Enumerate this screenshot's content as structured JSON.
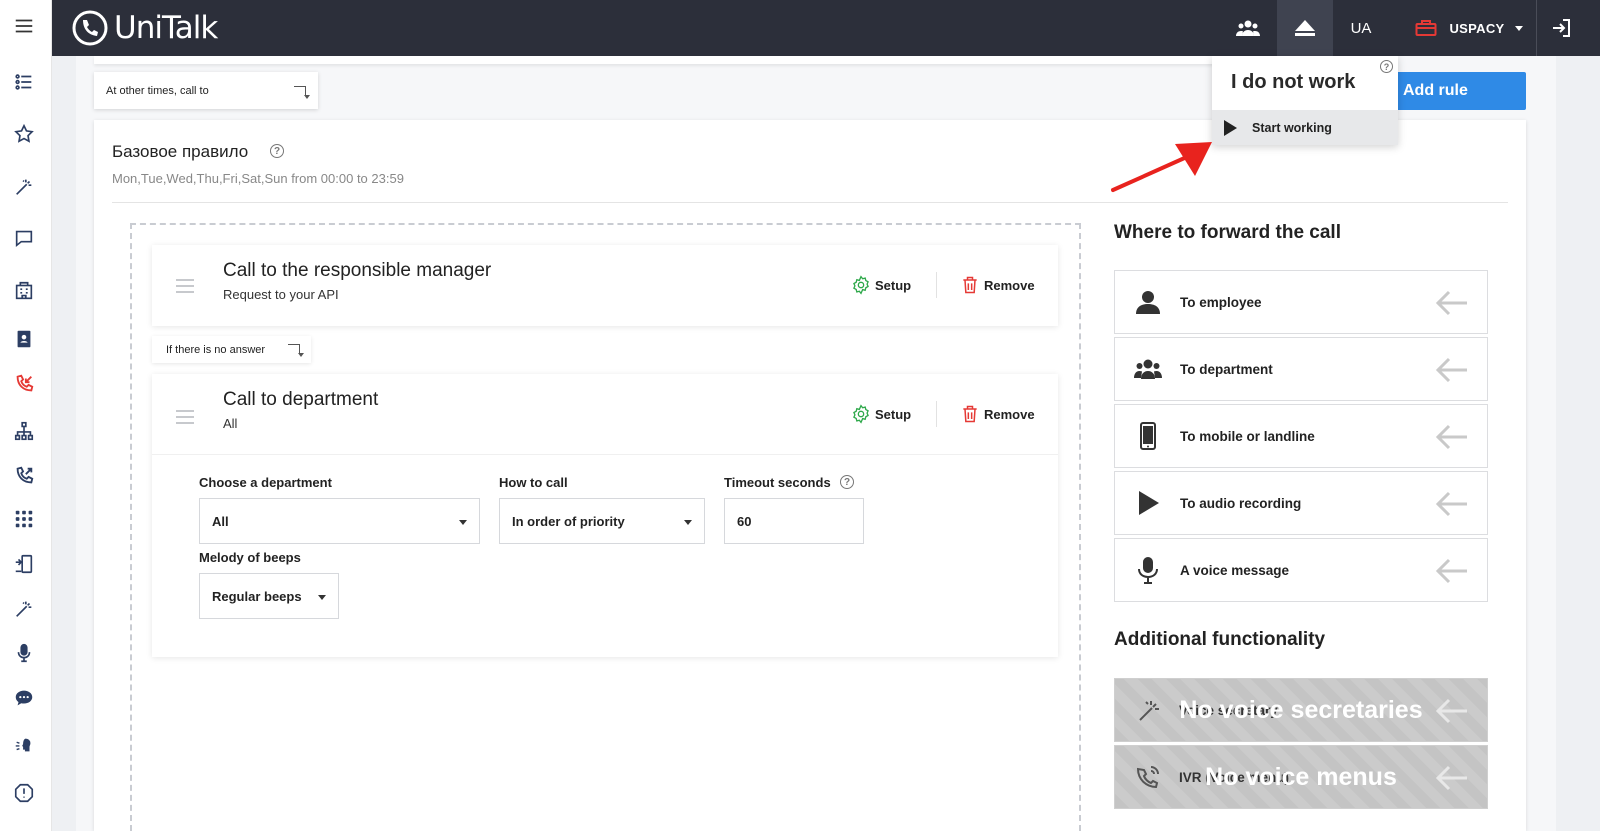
{
  "topbar": {
    "logo_text": "UniTalk",
    "lang": "UA",
    "company": "USPACY"
  },
  "top": {
    "other_times": "At other times, call to",
    "add_rule": "Add rule"
  },
  "status_dropdown": {
    "title": "I do not work",
    "action": "Start working"
  },
  "rule": {
    "title": "Базовое правило",
    "schedule": "Mon,Tue,Wed,Thu,Fri,Sat,Sun from 00:00 to 23:59"
  },
  "steps": [
    {
      "title": "Call to the responsible manager",
      "subtitle": "Request to your API",
      "setup": "Setup",
      "remove": "Remove"
    },
    {
      "title": "Call to department",
      "subtitle": "All",
      "setup": "Setup",
      "remove": "Remove"
    }
  ],
  "no_answer": "If there is no answer",
  "dept_form": {
    "department_label": "Choose a department",
    "department_value": "All",
    "how_label": "How to call",
    "how_value": "In order of priority",
    "timeout_label": "Timeout seconds",
    "timeout_value": "60",
    "melody_label": "Melody of beeps",
    "melody_value": "Regular beeps"
  },
  "forward": {
    "title": "Where to forward the call",
    "items": [
      {
        "label": "To employee",
        "icon": "person-icon"
      },
      {
        "label": "To department",
        "icon": "group-icon"
      },
      {
        "label": "To mobile or landline",
        "icon": "mobile-icon"
      },
      {
        "label": "To audio recording",
        "icon": "play-icon"
      },
      {
        "label": "A voice message",
        "icon": "microphone-icon"
      }
    ]
  },
  "additional": {
    "title": "Additional functionality",
    "items": [
      {
        "label": "Voice secretary",
        "overlay": "No voice secretaries",
        "icon": "magic-wand-icon"
      },
      {
        "label": "IVR (Voice menu)",
        "overlay": "No voice menus",
        "icon": "phone-waves-icon"
      }
    ]
  },
  "colors": {
    "topbar": "#2c2f3a",
    "accent_blue": "#2f8ae6",
    "setup_green": "#2ea84a",
    "remove_red": "#e53935",
    "annotation_arrow": "#e8231e"
  }
}
